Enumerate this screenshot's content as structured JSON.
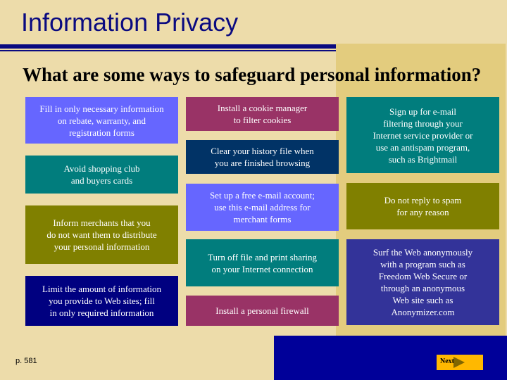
{
  "slide": {
    "title": "Information Privacy",
    "subtitle": "What are some ways to safeguard personal information?",
    "page_ref": "p. 581",
    "next_label": "Next"
  },
  "colors": {
    "background": "#eddcaa",
    "title": "#0a0a80",
    "gold_panel": "#e3cc7e",
    "blue_block": "#000099",
    "next_button": "#ffb800"
  },
  "columns": {
    "left": [
      {
        "text": "Fill in only necessary information\non rebate, warranty, and\nregistration forms",
        "color": "#6666ff"
      },
      {
        "text": "Avoid shopping club\nand buyers cards",
        "color": "#017d7d"
      },
      {
        "text": "Inform merchants that you\ndo not want them to distribute\nyour personal information",
        "color": "#808000"
      },
      {
        "text": "Limit the amount of information\nyou provide to Web sites; fill\nin only required information",
        "color": "#000080"
      }
    ],
    "middle": [
      {
        "text": "Install a cookie manager\nto filter cookies",
        "color": "#993366"
      },
      {
        "text": "Clear your history file when\nyou are finished browsing",
        "color": "#013366"
      },
      {
        "text": "Set up a free e-mail account;\nuse this e-mail address for\nmerchant forms",
        "color": "#6666ff"
      },
      {
        "text": "Turn off file and print sharing\non your Internet connection",
        "color": "#017d7d"
      },
      {
        "text": "Install a personal firewall",
        "color": "#993366"
      }
    ],
    "right": [
      {
        "text": "Sign up for e-mail\nfiltering through your\nInternet service provider or\nuse an antispam program,\nsuch as Brightmail",
        "color": "#017d7d"
      },
      {
        "text": "Do not reply to spam\nfor any reason",
        "color": "#808000"
      },
      {
        "text": "Surf the Web anonymously\nwith a program such as\nFreedom Web Secure or\nthrough an anonymous\nWeb site such as\nAnonymizer.com",
        "color": "#333399"
      }
    ]
  }
}
